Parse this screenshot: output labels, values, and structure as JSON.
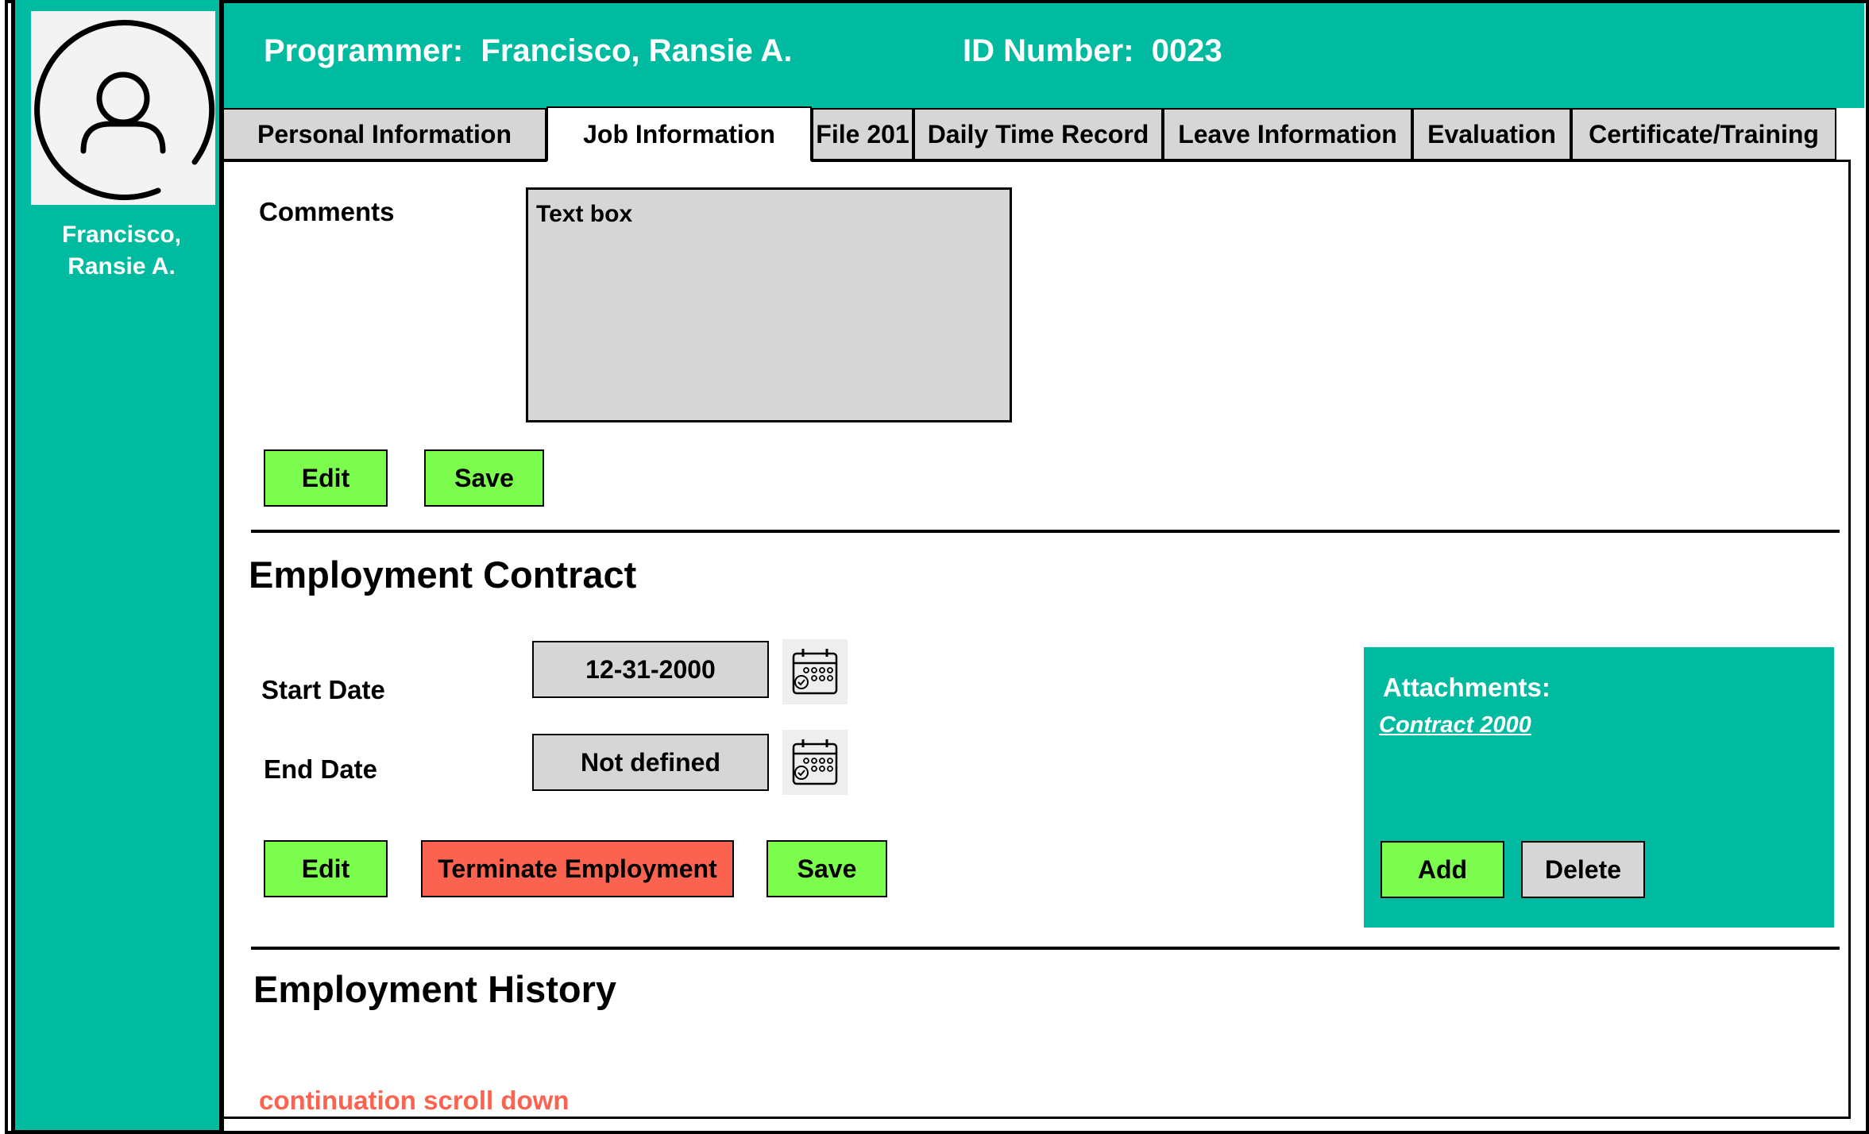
{
  "sidebar": {
    "name": "Francisco,\nRansie A."
  },
  "header": {
    "programmer_label": "Programmer:  Francisco, Ransie A.",
    "id_label": "ID Number:  0023"
  },
  "tabs": [
    {
      "label": "Personal Information",
      "active": false
    },
    {
      "label": "Job Information",
      "active": true
    },
    {
      "label": "File 201",
      "active": false
    },
    {
      "label": "Daily Time Record",
      "active": false
    },
    {
      "label": "Leave Information",
      "active": false
    },
    {
      "label": "Evaluation",
      "active": false
    },
    {
      "label": "Certificate/Training",
      "active": false
    }
  ],
  "comments": {
    "label": "Comments",
    "textbox_value": "Text box",
    "edit_label": "Edit",
    "save_label": "Save"
  },
  "contract": {
    "title": "Employment Contract",
    "start_label": "Start Date",
    "start_value": "12-31-2000",
    "end_label": "End Date",
    "end_value": "Not defined",
    "edit_label": "Edit",
    "terminate_label": "Terminate Employment",
    "save_label": "Save"
  },
  "attachments": {
    "title": "Attachments:",
    "link": "Contract 2000",
    "add_label": "Add",
    "delete_label": "Delete"
  },
  "history": {
    "title": "Employment History",
    "scroll_note": "continuation scroll down"
  },
  "colors": {
    "teal": "#00BBA0",
    "green_button": "#7CFC4C",
    "red_button": "#FB6350",
    "field_gray": "#d6d6d6"
  },
  "icons": {
    "avatar": "user-circle-icon",
    "calendar": "calendar-icon"
  }
}
